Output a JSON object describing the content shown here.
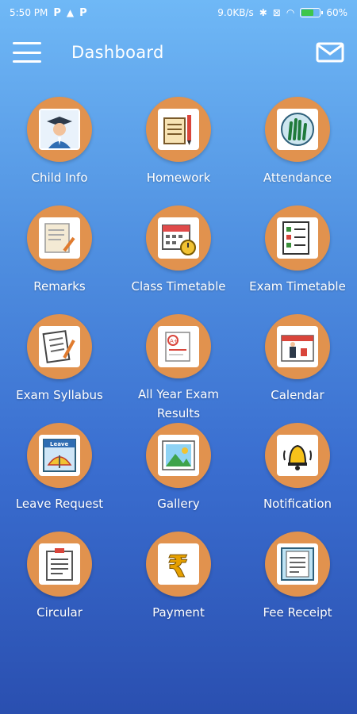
{
  "status": {
    "time": "5:50 PM",
    "network_speed": "9.0KB/s",
    "battery": "60%",
    "battery_level": 0.6
  },
  "header": {
    "title": "Dashboard"
  },
  "tiles": [
    {
      "label": "Child Info",
      "icon": "graduate-icon"
    },
    {
      "label": "Homework",
      "icon": "homework-icon"
    },
    {
      "label": "Attendance",
      "icon": "attendance-icon"
    },
    {
      "label": "Remarks",
      "icon": "remarks-icon"
    },
    {
      "label": "Class Timetable",
      "icon": "class-timetable-icon"
    },
    {
      "label": "Exam Timetable",
      "icon": "exam-timetable-icon"
    },
    {
      "label": "Exam Syllabus",
      "icon": "syllabus-icon"
    },
    {
      "label": "All Year Exam Results",
      "icon": "results-icon"
    },
    {
      "label": "Calendar",
      "icon": "calendar-icon"
    },
    {
      "label": "Leave Request",
      "icon": "leave-request-icon",
      "icon_text": "Leave"
    },
    {
      "label": "Gallery",
      "icon": "gallery-icon"
    },
    {
      "label": "Notification",
      "icon": "bell-icon"
    },
    {
      "label": "Circular",
      "icon": "circular-icon"
    },
    {
      "label": "Payment",
      "icon": "rupee-icon",
      "icon_text": "₹"
    },
    {
      "label": "Fee Receipt",
      "icon": "receipt-icon"
    }
  ],
  "colors": {
    "tile_circle": "#e1924e",
    "bg_top": "#6fb8f6",
    "bg_bottom": "#2a4fb0"
  }
}
